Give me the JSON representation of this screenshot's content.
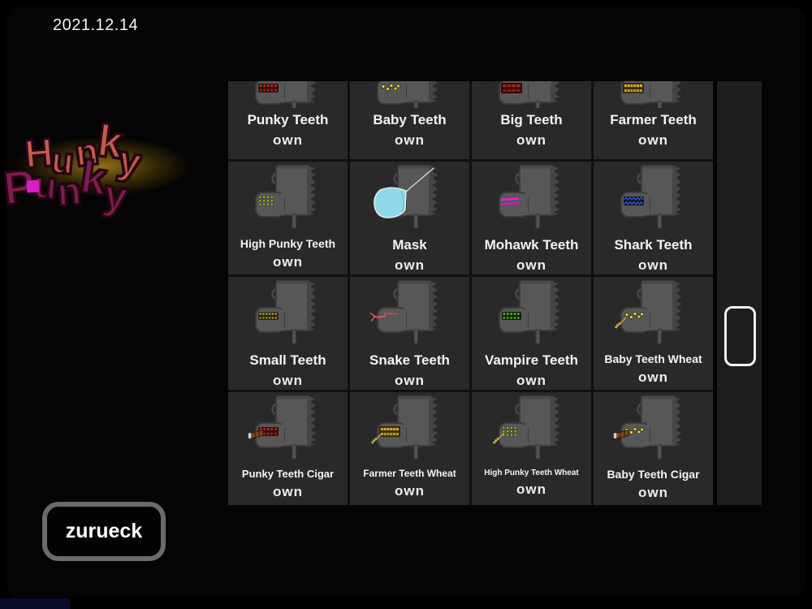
{
  "date": "2021.12.14",
  "logo": {
    "line1": "Hunky",
    "line2": "Punky"
  },
  "back_button": {
    "label": "zurueck"
  },
  "shop": {
    "items": [
      {
        "name": "Punky Teeth",
        "status": "own",
        "variant": "punky",
        "accessory": "none"
      },
      {
        "name": "Baby Teeth",
        "status": "own",
        "variant": "baby",
        "accessory": "none"
      },
      {
        "name": "Big Teeth",
        "status": "own",
        "variant": "big",
        "accessory": "none"
      },
      {
        "name": "Farmer Teeth",
        "status": "own",
        "variant": "farmer",
        "accessory": "none"
      },
      {
        "name": "High Punky Teeth",
        "status": "own",
        "variant": "highpunky",
        "accessory": "none"
      },
      {
        "name": "Mask",
        "status": "own",
        "variant": "mask",
        "accessory": "none"
      },
      {
        "name": "Mohawk Teeth",
        "status": "own",
        "variant": "mohawk",
        "accessory": "none"
      },
      {
        "name": "Shark Teeth",
        "status": "own",
        "variant": "shark",
        "accessory": "none"
      },
      {
        "name": "Small Teeth",
        "status": "own",
        "variant": "small",
        "accessory": "none"
      },
      {
        "name": "Snake Teeth",
        "status": "own",
        "variant": "snake",
        "accessory": "none"
      },
      {
        "name": "Vampire Teeth",
        "status": "own",
        "variant": "vampire",
        "accessory": "none"
      },
      {
        "name": "Baby Teeth Wheat",
        "status": "own",
        "variant": "baby",
        "accessory": "wheat"
      },
      {
        "name": "Punky Teeth Cigar",
        "status": "own",
        "variant": "punky",
        "accessory": "cigar"
      },
      {
        "name": "Farmer Teeth Wheat",
        "status": "own",
        "variant": "farmer",
        "accessory": "wheat"
      },
      {
        "name": "High Punky Teeth Wheat",
        "status": "own",
        "variant": "highpunky",
        "accessory": "wheat"
      },
      {
        "name": "Baby Teeth Cigar",
        "status": "own",
        "variant": "baby",
        "accessory": "cigar"
      }
    ]
  },
  "colors": {
    "logo_hunky": "#c65a4e",
    "logo_punky": "#7e1c52",
    "logo_pip": "#d81ec8",
    "glow": "#b8860b",
    "cell_bg": "#292929",
    "teeth": {
      "punky": "#c33026",
      "baby": "#e8d44a",
      "big": "#aa2018",
      "farmer": "#cfa92e",
      "highpunky": "#a6c433",
      "mohawk": "#ec1fd2",
      "shark": "#3450bc",
      "small": "#e0ca3e",
      "snake": "#e05050",
      "vampire": "#55b836",
      "mask": "#8ed9e9"
    },
    "accessories": {
      "wheat": "#c4a438",
      "cigar": "#7e461a"
    }
  }
}
